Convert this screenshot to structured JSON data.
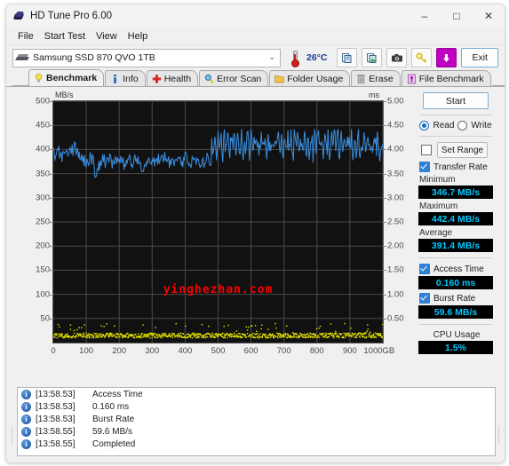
{
  "window": {
    "title": "HD Tune Pro 6.00",
    "icon": "hdtune-logo-icon",
    "minimize": "–",
    "maximize": "□",
    "close": "✕"
  },
  "menu": {
    "items": [
      {
        "label": "File"
      },
      {
        "label": "Start Test"
      },
      {
        "label": "View"
      },
      {
        "label": "Help"
      }
    ]
  },
  "toolbar": {
    "drive": "Samsung SSD 870 QVO 1TB",
    "drive_caret": "⌄",
    "temperature": "26°C",
    "buttons": [
      {
        "name": "copy-icon"
      },
      {
        "name": "copy-image-icon"
      },
      {
        "name": "camera-icon"
      },
      {
        "name": "settings-icon"
      },
      {
        "name": "download-icon"
      }
    ],
    "exit_label": "Exit"
  },
  "tabs": [
    {
      "label": "Benchmark",
      "icon": "lightbulb-icon",
      "active": true
    },
    {
      "label": "Info",
      "icon": "info-icon",
      "active": false
    },
    {
      "label": "Health",
      "icon": "health-cross-icon",
      "active": false
    },
    {
      "label": "Error Scan",
      "icon": "magnifier-icon",
      "active": false
    },
    {
      "label": "Folder Usage",
      "icon": "folder-icon",
      "active": false
    },
    {
      "label": "Erase",
      "icon": "trash-icon",
      "active": false
    },
    {
      "label": "File Benchmark",
      "icon": "file-benchmark-icon",
      "active": false
    }
  ],
  "controls": {
    "start_label": "Start",
    "read_label": "Read",
    "write_label": "Write",
    "read_selected": true,
    "set_range_label": "Set Range",
    "set_range_checked": false,
    "transfer_rate_label": "Transfer Rate",
    "transfer_rate_checked": true,
    "access_time_label": "Access Time",
    "access_time_checked": true,
    "burst_rate_label": "Burst Rate",
    "burst_rate_checked": true,
    "cpu_usage_label": "CPU Usage"
  },
  "stats": {
    "minimum_label": "Minimum",
    "minimum_value": "346.7 MB/s",
    "maximum_label": "Maximum",
    "maximum_value": "442.4 MB/s",
    "average_label": "Average",
    "average_value": "391.4 MB/s",
    "access_time_value": "0.160 ms",
    "burst_rate_value": "59.6 MB/s",
    "cpu_usage_value": "1.5%"
  },
  "progress": {
    "percent": 100
  },
  "watermark": "yinghezhan.com",
  "log": {
    "entries": [
      {
        "time": "[13:58.53]",
        "message": "Access Time"
      },
      {
        "time": "[13:58.53]",
        "message": "0.160 ms"
      },
      {
        "time": "[13:58.53]",
        "message": "Burst Rate"
      },
      {
        "time": "[13:58.55]",
        "message": "59.6 MB/s"
      },
      {
        "time": "[13:58.55]",
        "message": "Completed"
      }
    ]
  },
  "chart_data": {
    "type": "line",
    "title": "",
    "xlabel": "1000GB",
    "ylabel": "MB/s",
    "y2label": "ms",
    "xlim": [
      0,
      1000
    ],
    "ylim": [
      0,
      500
    ],
    "y2lim": [
      0,
      5.0
    ],
    "grid": true,
    "legend": "none",
    "xticks": [
      0,
      100,
      200,
      300,
      400,
      500,
      600,
      700,
      800,
      900,
      1000
    ],
    "xticklabels": [
      "0",
      "100",
      "200",
      "300",
      "400",
      "500",
      "600",
      "700",
      "800",
      "900",
      "1000GB"
    ],
    "yticks": [
      50,
      100,
      150,
      200,
      250,
      300,
      350,
      400,
      450,
      500
    ],
    "yticklabels": [
      "50",
      "100",
      "150",
      "200",
      "250",
      "300",
      "350",
      "400",
      "450",
      "500"
    ],
    "y2ticks": [
      0.5,
      1.0,
      1.5,
      2.0,
      2.5,
      3.0,
      3.5,
      4.0,
      4.5,
      5.0
    ],
    "y2ticklabels": [
      "0.50",
      "1.00",
      "1.50",
      "2.00",
      "2.50",
      "3.00",
      "3.50",
      "4.00",
      "4.50",
      "5.00"
    ],
    "colors": {
      "transfer_rate": "#3b8fe0",
      "access_time": "#e8e800",
      "background": "#111111",
      "grid": "#4a4a4a"
    },
    "series": [
      {
        "name": "Transfer Rate",
        "axis": "left",
        "unit": "MB/s",
        "color": "#3b8fe0",
        "x": [
          0,
          8,
          16,
          24,
          32,
          40,
          48,
          56,
          64,
          72,
          80,
          88,
          96,
          104,
          112,
          120,
          128,
          136,
          144,
          152,
          160,
          168,
          176,
          184,
          192,
          200,
          208,
          216,
          224,
          232,
          240,
          248,
          256,
          264,
          272,
          280,
          288,
          296,
          304,
          312,
          320,
          328,
          336,
          344,
          352,
          360,
          368,
          376,
          384,
          392,
          400,
          408,
          416,
          424,
          432,
          440,
          448,
          456,
          464,
          472,
          480,
          488,
          496,
          504,
          512,
          520,
          528,
          536,
          544,
          552,
          560,
          568,
          576,
          584,
          592,
          600,
          608,
          616,
          624,
          632,
          640,
          648,
          656,
          664,
          672,
          680,
          688,
          696,
          704,
          712,
          720,
          728,
          736,
          744,
          752,
          760,
          768,
          776,
          784,
          792,
          800,
          808,
          816,
          824,
          832,
          840,
          848,
          856,
          864,
          872,
          880,
          888,
          896,
          904,
          912,
          920,
          928,
          936,
          944,
          952,
          960,
          968,
          976,
          984,
          992,
          1000
        ],
        "values": [
          392,
          378,
          386,
          372,
          390,
          399,
          408,
          411,
          406,
          398,
          390,
          383,
          377,
          372,
          384,
          379,
          347,
          361,
          374,
          380,
          371,
          383,
          376,
          367,
          379,
          384,
          374,
          369,
          382,
          376,
          371,
          386,
          379,
          370,
          358,
          366,
          377,
          383,
          374,
          368,
          381,
          375,
          386,
          378,
          371,
          383,
          377,
          369,
          380,
          374,
          387,
          379,
          372,
          384,
          377,
          366,
          379,
          371,
          383,
          376,
          369,
          381,
          374,
          386,
          378,
          371,
          383,
          376,
          389,
          381,
          374,
          386,
          379,
          390,
          383,
          375,
          388,
          380,
          392,
          384,
          377,
          389,
          382,
          394,
          386,
          379,
          391,
          384,
          396,
          388,
          381,
          393,
          386,
          398,
          390,
          383,
          395,
          388,
          400,
          392,
          385,
          397,
          390,
          402,
          394,
          387,
          399,
          392,
          404,
          396,
          389,
          401,
          394,
          406,
          398,
          391,
          403,
          396,
          408,
          400,
          393,
          405,
          398,
          410,
          402,
          395
        ]
      },
      {
        "name": "Transfer Rate (high-variance zone)",
        "axis": "left",
        "unit": "MB/s",
        "color": "#3b8fe0",
        "note": "after approximately 480GB the curve oscillates rapidly between about 378 and 442 MB/s",
        "range": [
          378,
          442
        ],
        "start_gb": 480
      },
      {
        "name": "Access Time",
        "axis": "right",
        "unit": "ms",
        "color": "#e8e800",
        "mean": 0.16,
        "range": [
          0.05,
          0.45
        ],
        "note": "dense scatter of yellow dots along the bottom of the plot near 0.16 ms"
      }
    ]
  }
}
